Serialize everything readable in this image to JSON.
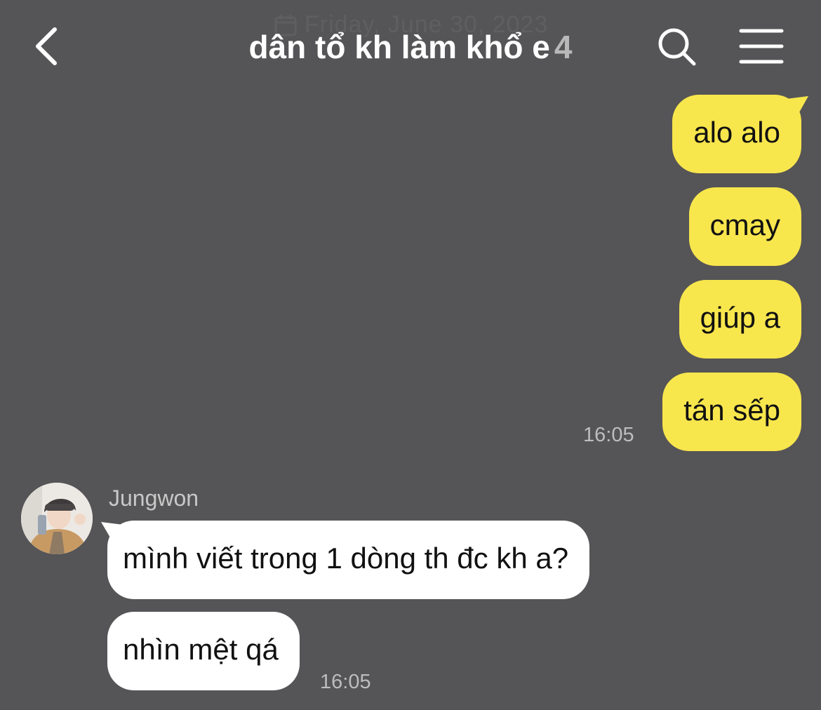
{
  "date_divider": "Friday, June 30, 2023",
  "header": {
    "title": "dân tổ kh làm khổ e",
    "member_count": "4"
  },
  "outgoing": {
    "messages": [
      "alo alo",
      "cmay",
      "giúp a",
      "tán sếp"
    ],
    "time": "16:05"
  },
  "incoming": {
    "sender": "Jungwon",
    "messages": [
      "mình viết trong 1 dòng th đc kh a?",
      "nhìn mệt qá"
    ],
    "time": "16:05"
  },
  "colors": {
    "background": "#555456",
    "outgoing_bubble": "#f8e64d",
    "incoming_bubble": "#ffffff"
  },
  "icons": [
    "back-arrow-icon",
    "search-icon",
    "menu-icon",
    "calendar-icon"
  ]
}
